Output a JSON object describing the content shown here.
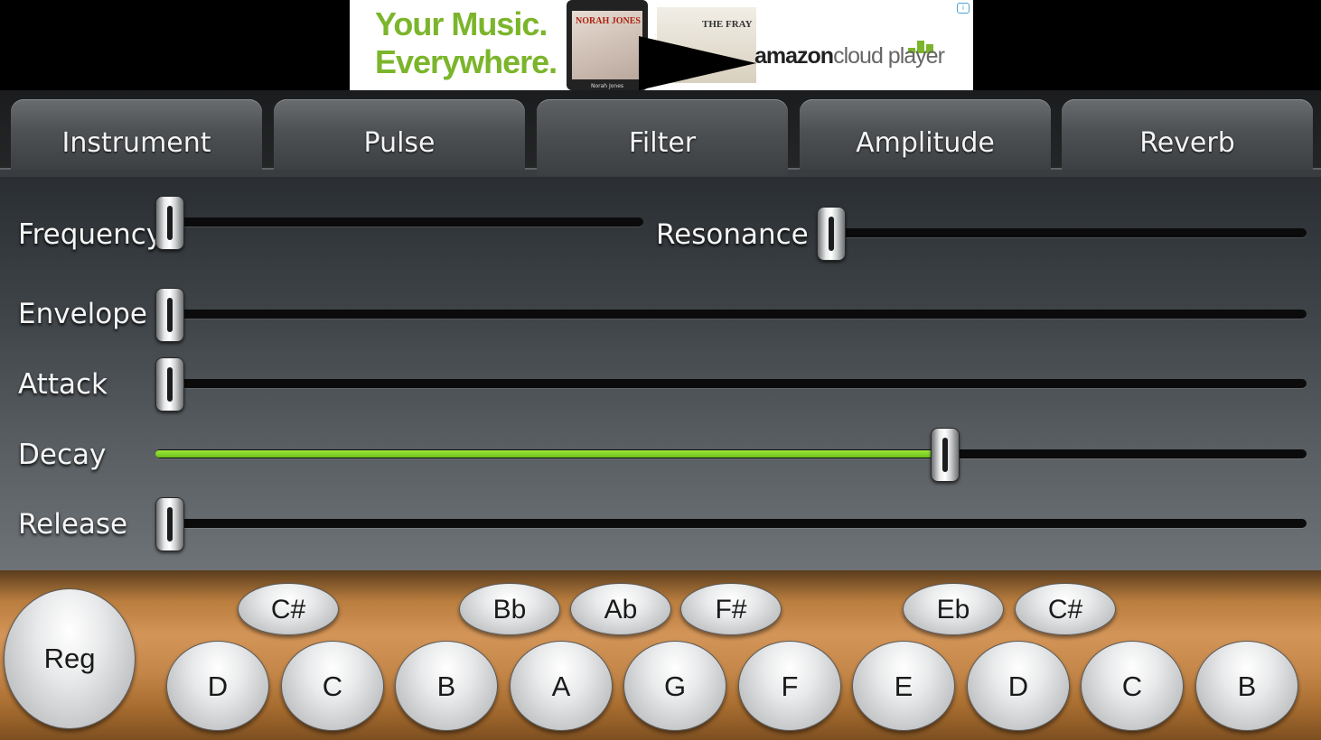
{
  "ad": {
    "slogan_line1": "Your Music.",
    "slogan_line2": "Everywhere.",
    "album1_text": "NORAH JONES",
    "album1_caption": "Norah Jones",
    "album2_text": "THE FRAY",
    "brand_bold": "amazon",
    "brand_light": "cloud player",
    "info_label": "i"
  },
  "tabs": [
    {
      "label": "Instrument",
      "active": false
    },
    {
      "label": "Pulse",
      "active": false
    },
    {
      "label": "Filter",
      "active": true
    },
    {
      "label": "Amplitude",
      "active": false
    },
    {
      "label": "Reverb",
      "active": false
    }
  ],
  "sliders": {
    "frequency": {
      "label": "Frequency",
      "value": 0.0
    },
    "resonance": {
      "label": "Resonance",
      "value": 0.0
    },
    "envelope": {
      "label": "Envelope",
      "value": 0.0
    },
    "attack": {
      "label": "Attack",
      "value": 0.0
    },
    "decay": {
      "label": "Decay",
      "value": 0.69
    },
    "release": {
      "label": "Release",
      "value": 0.0
    }
  },
  "colors": {
    "accent_green": "#7ed321",
    "ad_green": "#7bb52b"
  },
  "keyboard": {
    "reg_label": "Reg",
    "accidentals": [
      "C#",
      "Bb",
      "Ab",
      "F#",
      "Eb",
      "C#"
    ],
    "naturals": [
      "D",
      "C",
      "B",
      "A",
      "G",
      "F",
      "E",
      "D",
      "C",
      "B"
    ]
  }
}
